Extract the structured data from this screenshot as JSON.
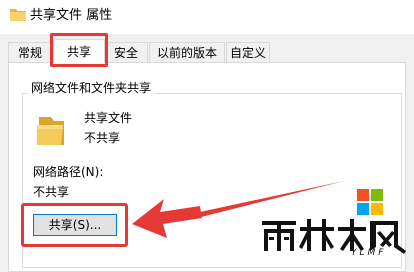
{
  "window": {
    "title": "共享文件 属性",
    "title_icon": "folder-icon"
  },
  "tabs": [
    {
      "label": "常规",
      "active": false
    },
    {
      "label": "共享",
      "active": true
    },
    {
      "label": "安全",
      "active": false
    },
    {
      "label": "以前的版本",
      "active": false
    },
    {
      "label": "自定义",
      "active": false
    }
  ],
  "sharing": {
    "group_title": "网络文件和文件夹共享",
    "item_name": "共享文件",
    "item_status": "不共享",
    "item_icon": "folder-icon",
    "network_path_label": "网络路径(N):",
    "network_path_value": "不共享",
    "share_button_label": "共享(S)..."
  },
  "annotations": {
    "highlight_color": "#e53935",
    "arrow_color": "#e53935"
  },
  "watermark": {
    "brand": "雨林木风",
    "tagline": "YLMF",
    "tile_colors": [
      "#f25022",
      "#7fba00",
      "#00a4ef",
      "#ffb900"
    ]
  }
}
